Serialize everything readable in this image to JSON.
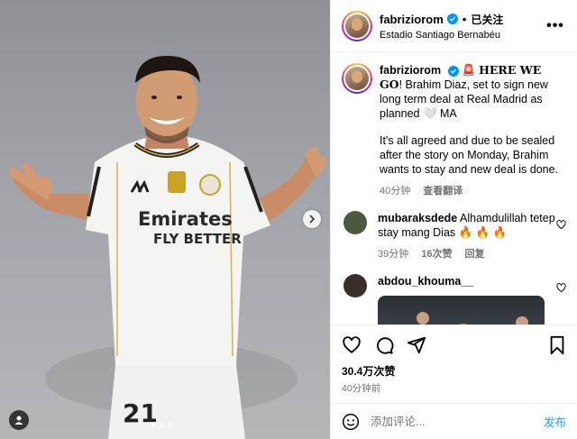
{
  "post": {
    "username": "fabriziorom",
    "follow_state": "已关注",
    "location": "Estadio Santiago Bernabéu",
    "more": "•••"
  },
  "media": {
    "jersey_sponsor_line1": "Emirates",
    "jersey_sponsor_line2": "FLY BETTER",
    "jersey_number": "21",
    "carousel_count": 3,
    "carousel_active": 1
  },
  "caption": {
    "username": "fabriziorom",
    "emoji": "🚨",
    "headline": "HERE WE GO",
    "text1": "! Brahim Diaz, set to sign new long term deal at Real Madrid as planned 🤍 MA",
    "text2": "It's all agreed and due to be sealed after the story on Monday, Brahim wants to stay and new deal is done.",
    "time": "40分钟",
    "translate": "查看翻译"
  },
  "comments": [
    {
      "username": "mubaraksdede",
      "text": "Alhamdulillah tetep stay mang Dias 🔥 🔥 🔥",
      "time": "39分钟",
      "likes": "16次赞",
      "reply": "回复",
      "avatar_color": "#4b5a3c"
    },
    {
      "username": "abdou_khouma__",
      "text": "",
      "avatar_color": "#3a2e26"
    }
  ],
  "stats": {
    "likes": "30.4万次赞",
    "time": "40分钟前"
  },
  "composer": {
    "placeholder": "添加评论...",
    "post_label": "发布"
  },
  "icons": {
    "like": "heart-icon",
    "comment": "comment-icon",
    "share": "send-icon",
    "save": "bookmark-icon",
    "emoji": "emoji-icon"
  },
  "colors": {
    "verified": "#0095f6",
    "post_button": "#0095f6",
    "secondary_text": "#737373"
  }
}
